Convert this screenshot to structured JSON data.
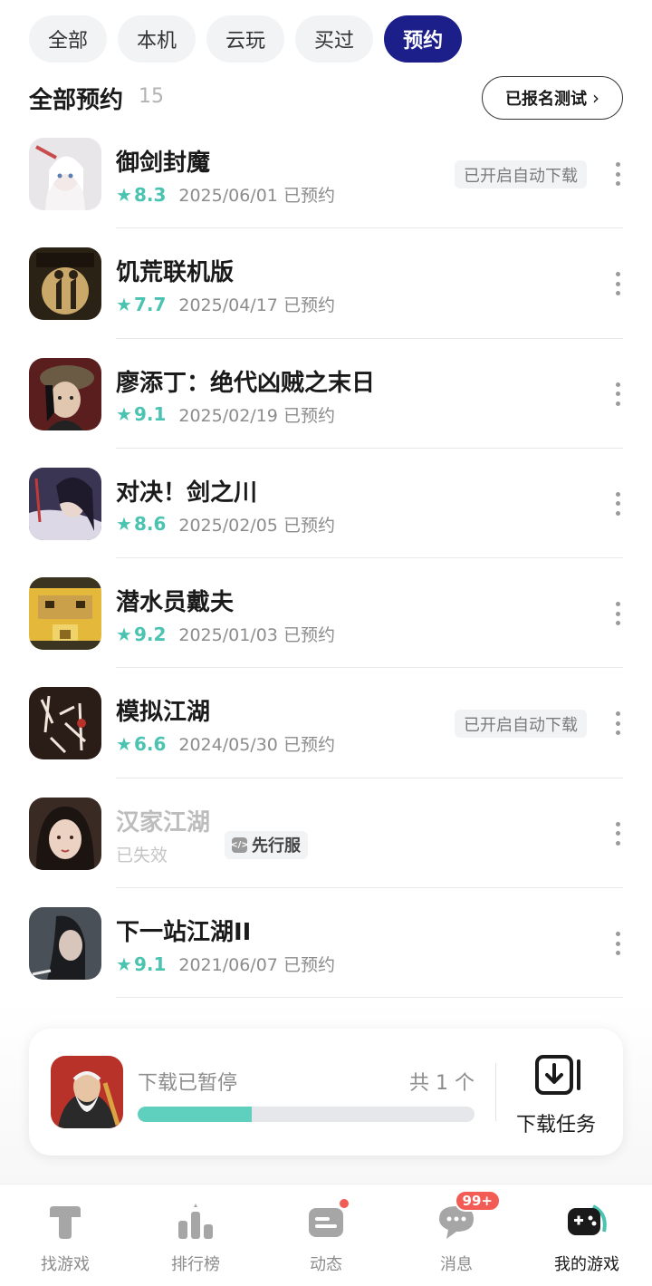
{
  "filter_tabs": [
    {
      "label": "全部",
      "active": false
    },
    {
      "label": "本机",
      "active": false
    },
    {
      "label": "云玩",
      "active": false
    },
    {
      "label": "买过",
      "active": false
    },
    {
      "label": "预约",
      "active": true
    }
  ],
  "section": {
    "title": "全部预约",
    "count": "15",
    "tested_button": "已报名测试"
  },
  "games": [
    {
      "name": "御剑封魔",
      "score": "8.3",
      "date": "2025/06/01",
      "status": "已预约",
      "auto_download": "已开启自动下载",
      "icon": "warrior-girl-portrait"
    },
    {
      "name": "饥荒联机版",
      "score": "7.7",
      "date": "2025/04/17",
      "status": "已预约",
      "auto_download": null,
      "icon": "dont-starve-art"
    },
    {
      "name": "廖添丁：绝代凶贼之末日",
      "score": "9.1",
      "date": "2025/02/19",
      "status": "已预约",
      "auto_download": null,
      "icon": "capped-thief-portrait"
    },
    {
      "name": "对决！剑之川",
      "score": "8.6",
      "date": "2025/02/05",
      "status": "已预约",
      "auto_download": null,
      "icon": "swordsman-portrait"
    },
    {
      "name": "潜水员戴夫",
      "score": "9.2",
      "date": "2025/01/03",
      "status": "已预约",
      "auto_download": null,
      "icon": "pixel-diver-face"
    },
    {
      "name": "模拟江湖",
      "score": "6.6",
      "date": "2024/05/30",
      "status": "已预约",
      "auto_download": "已开启自动下载",
      "icon": "calligraphy-logo"
    },
    {
      "name": "汉家江湖",
      "score": null,
      "date": null,
      "status": "已失效",
      "auto_download": null,
      "tag": "先行服",
      "icon": "lady-portrait"
    },
    {
      "name": "下一站江湖II",
      "score": "9.1",
      "date": "2021/06/07",
      "status": "已预约",
      "auto_download": null,
      "icon": "hero-portrait"
    }
  ],
  "download": {
    "status": "下载已暂停",
    "count": "共 1 个",
    "progress": 0.34,
    "task_label": "下载任务",
    "icon": "old-master-portrait"
  },
  "bottom_nav": [
    {
      "label": "找游戏",
      "icon": "find-game-icon",
      "active": false
    },
    {
      "label": "排行榜",
      "icon": "ranking-icon",
      "active": false
    },
    {
      "label": "动态",
      "icon": "feed-icon",
      "active": false,
      "dot": true
    },
    {
      "label": "消息",
      "icon": "message-icon",
      "active": false,
      "badge": "99+"
    },
    {
      "label": "我的游戏",
      "icon": "my-games-icon",
      "active": true
    }
  ],
  "colors": {
    "accent": "#1c1f8a",
    "score": "#4bc3b1",
    "progress": "#5fd0bd",
    "badge": "#f25c54"
  }
}
